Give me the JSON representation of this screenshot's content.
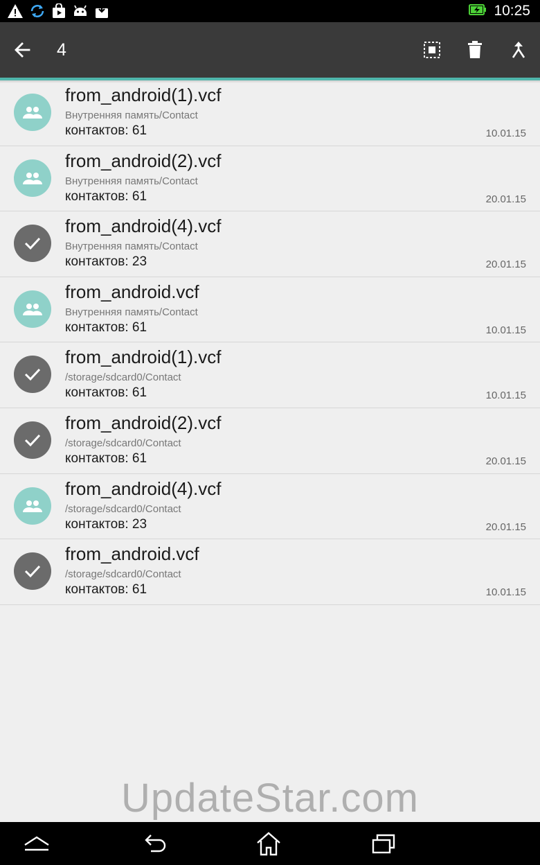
{
  "status_bar": {
    "time": "10:25",
    "icons": [
      "warning-icon",
      "sync-icon",
      "store-icon",
      "android-icon",
      "download-icon",
      "battery-charging-icon"
    ]
  },
  "app_bar": {
    "selected_count": "4",
    "actions": [
      "select-all-icon",
      "delete-icon",
      "merge-icon"
    ]
  },
  "files": [
    {
      "name": "from_android(1).vcf",
      "path": "Внутренняя память/Contact",
      "count": "контактов: 61",
      "date": "10.01.15",
      "checked": false
    },
    {
      "name": "from_android(2).vcf",
      "path": "Внутренняя память/Contact",
      "count": "контактов: 61",
      "date": "20.01.15",
      "checked": false
    },
    {
      "name": "from_android(4).vcf",
      "path": "Внутренняя память/Contact",
      "count": "контактов: 23",
      "date": "20.01.15",
      "checked": true
    },
    {
      "name": "from_android.vcf",
      "path": "Внутренняя память/Contact",
      "count": "контактов: 61",
      "date": "10.01.15",
      "checked": false
    },
    {
      "name": "from_android(1).vcf",
      "path": "/storage/sdcard0/Contact",
      "count": "контактов: 61",
      "date": "10.01.15",
      "checked": true
    },
    {
      "name": "from_android(2).vcf",
      "path": "/storage/sdcard0/Contact",
      "count": "контактов: 61",
      "date": "20.01.15",
      "checked": true
    },
    {
      "name": "from_android(4).vcf",
      "path": "/storage/sdcard0/Contact",
      "count": "контактов: 23",
      "date": "20.01.15",
      "checked": false
    },
    {
      "name": "from_android.vcf",
      "path": "/storage/sdcard0/Contact",
      "count": "контактов: 61",
      "date": "10.01.15",
      "checked": true
    }
  ],
  "watermark": "UpdateStar.com",
  "colors": {
    "accent": "#4fb6ab",
    "avatar_group": "#8fd1c9",
    "avatar_checked": "#6b6b6b",
    "app_bar": "#3a3a3a"
  }
}
